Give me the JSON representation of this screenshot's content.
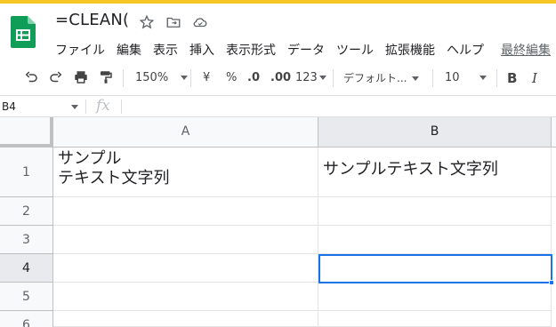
{
  "document": {
    "title": "=CLEAN(",
    "last_edit": "最終編集"
  },
  "menu": [
    "ファイル",
    "編集",
    "表示",
    "挿入",
    "表示形式",
    "データ",
    "ツール",
    "拡張機能",
    "ヘルプ"
  ],
  "toolbar": {
    "zoom": "150%",
    "currency": "¥",
    "percent": "%",
    "decrease_decimals": ".0",
    "increase_decimals": ".00",
    "number_format": "123",
    "font": "デフォルト...",
    "font_size": "10",
    "bold": "B",
    "italic": "I"
  },
  "formula_bar": {
    "name_box": "B4",
    "fx": "fx",
    "value": ""
  },
  "columns": [
    "A",
    "B"
  ],
  "rows": [
    "1",
    "2",
    "3",
    "4",
    "5",
    "6"
  ],
  "cells": {
    "A1": "サンプル\nテキスト文字列",
    "B1": "サンプルテキスト文字列"
  },
  "colors": {
    "accent": "#1a73e8",
    "sheets_green": "#0f9d58",
    "top_stripe": "#f3c623"
  }
}
